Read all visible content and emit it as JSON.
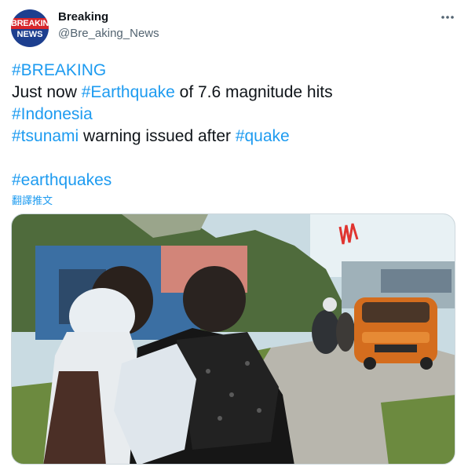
{
  "author": {
    "display_name": "Breaking",
    "handle": "@Bre_aking_News",
    "avatar_line1": "BREAKING",
    "avatar_line2": "NEWS"
  },
  "tweet": {
    "line1": {
      "tag": "#BREAKING"
    },
    "line2": {
      "prefix": "Just now ",
      "tag": "#Earthquake",
      "suffix": " of 7.6 magnitude hits"
    },
    "line3": {
      "tag": "#Indonesia"
    },
    "line4": {
      "tag1": "#tsunami",
      "middle": " warning issued after ",
      "tag2": "#quake"
    },
    "line6": {
      "tag": "#earthquakes"
    },
    "translate_link": "翻譯推文"
  },
  "media": {
    "type": "video-still",
    "description_icon": "video-frame"
  },
  "icons": {
    "more": "more-horizontal-icon"
  },
  "colors": {
    "link": "#1d9bf0",
    "text": "#0f1419",
    "secondary": "#536471",
    "avatar_red": "#d7262b",
    "avatar_blue": "#1d3f8f"
  }
}
